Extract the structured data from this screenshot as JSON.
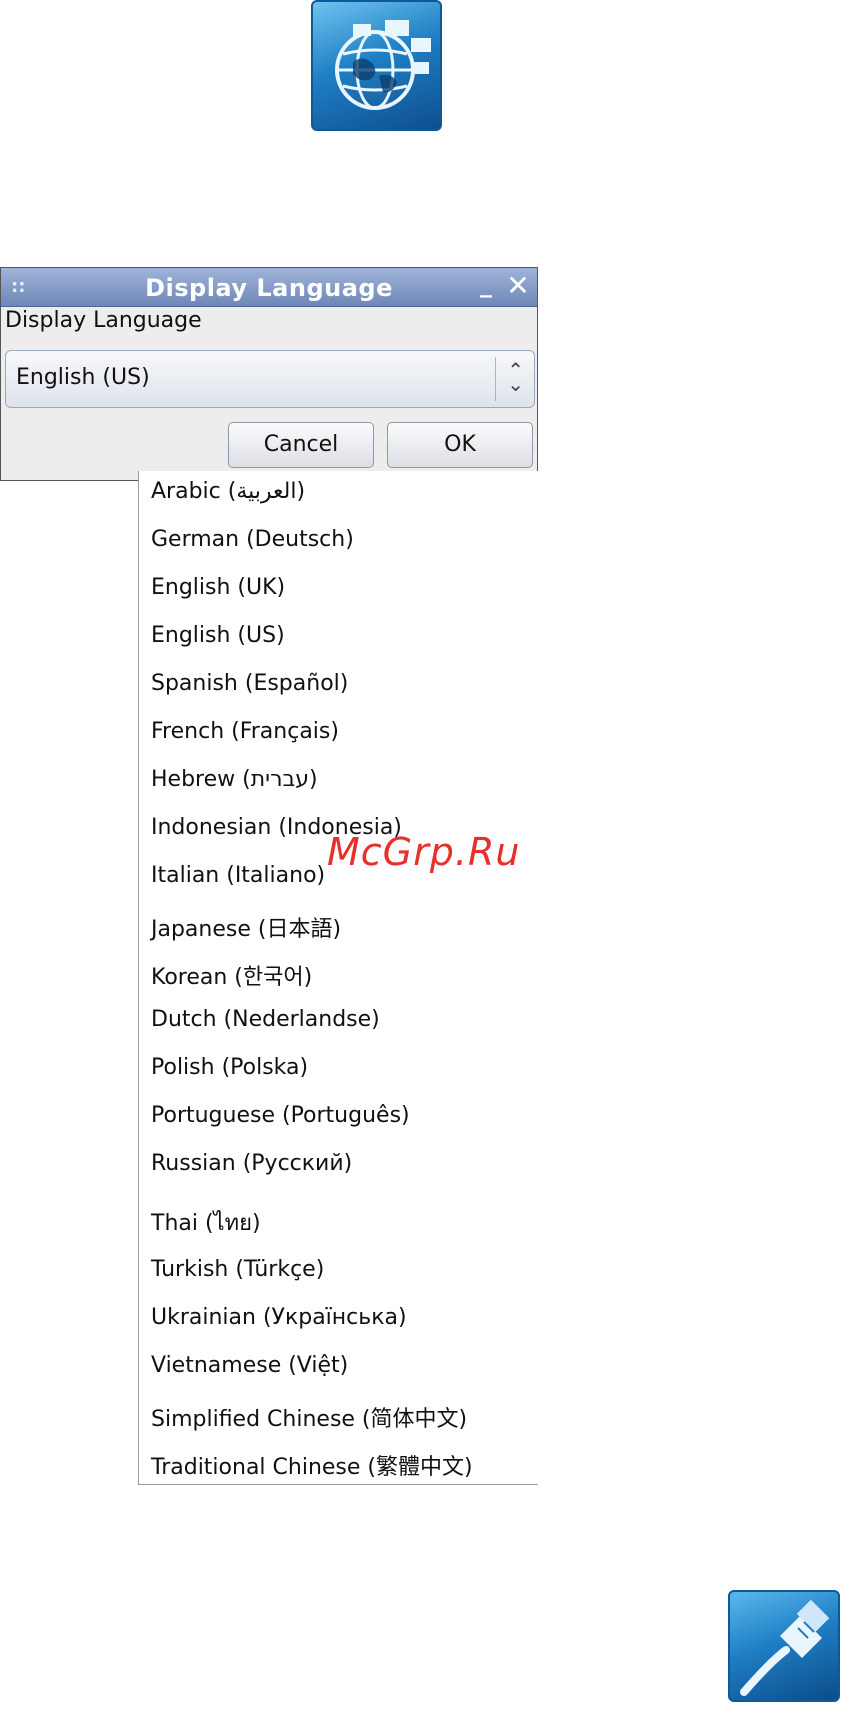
{
  "dialog": {
    "title": "Display Language",
    "label": "Display Language",
    "combo_value": "English (US)",
    "cancel_label": "Cancel",
    "ok_label": "OK"
  },
  "languages": [
    "Arabic (العربية)",
    "German (Deutsch)",
    "English (UK)",
    "English (US)",
    "Spanish (Español)",
    "French (Français)",
    "Hebrew (עברית)",
    "Indonesian (Indonesia)",
    "Italian (Italiano)",
    "Japanese (日本語)",
    "Korean (한국어)",
    "Dutch (Nederlandse)",
    "Polish (Polska)",
    "Portuguese (Português)",
    "Russian (Русский)",
    "Thai (ไทย)",
    "Turkish (Türkçe)",
    "Ukrainian (Українська)",
    "Vietnamese (Việt)",
    "Simplified Chinese (简体中文)",
    "Traditional Chinese (繁體中文)"
  ],
  "watermark": "McGrp.Ru",
  "icons": {
    "top": "globe-language-icon",
    "bottom": "network-cable-icon"
  },
  "colors": {
    "titlebar": "#7f97c6",
    "icon_blue": "#1f7fc4",
    "watermark": "#e8302a"
  }
}
